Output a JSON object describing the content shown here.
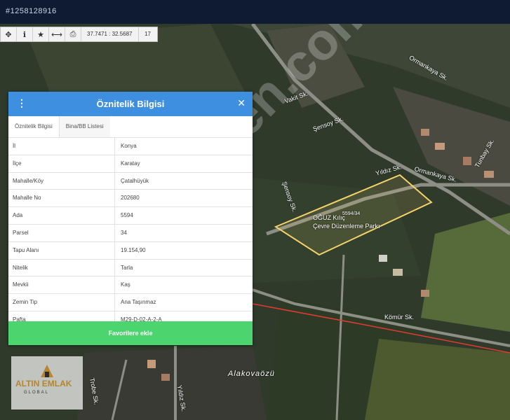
{
  "listing_id": "#1258128916",
  "toolbar": {
    "coordinates": "37.7471 : 32.5687",
    "zoom": "17"
  },
  "panel": {
    "title": "Öznitelik Bilgisi",
    "tabs": [
      "Öznitelik Bilgisi",
      "Bina/BB Listesi"
    ],
    "rows": [
      {
        "key": "İl",
        "value": "Konya"
      },
      {
        "key": "İlçe",
        "value": "Karatay"
      },
      {
        "key": "Mahalle/Köy",
        "value": "Çatalhüyük"
      },
      {
        "key": "Mahalle No",
        "value": "202680"
      },
      {
        "key": "Ada",
        "value": "5594"
      },
      {
        "key": "Parsel",
        "value": "34"
      },
      {
        "key": "Tapu Alanı",
        "value": "19.154,90"
      },
      {
        "key": "Nitelik",
        "value": "Tarla"
      },
      {
        "key": "Mevkii",
        "value": "Kaş"
      },
      {
        "key": "Zemin Tip",
        "value": "Ana Taşınmaz"
      },
      {
        "key": "Pafta",
        "value": "M29-D-02-A-2-A"
      }
    ],
    "favorite_button": "Favorilere ekle"
  },
  "map": {
    "streets": [
      "Ormankaya Sk.",
      "Vakit Sk.",
      "Şensoy Sk.",
      "Tunbay Sk.",
      "Yıldız Sk.",
      "Ormankaya Sk.",
      "Şensoy Sk.",
      "Kömür Sk.",
      "Alakovaözü",
      "Yıldız Sk.",
      "Trobe Sk."
    ],
    "parcel": {
      "label_line1": "OĞUZ Kılıç",
      "label_line2": "Çevre Düzenleme Parkı",
      "number": "5594/34"
    },
    "watermark": "sahibinden.com"
  },
  "logo": {
    "title": "ALTIN EMLAK",
    "subtitle": "GLOBAL"
  },
  "colors": {
    "header": "#3f8fe0",
    "favorite": "#4cd46f",
    "topbar": "#0f1b33",
    "parcel_outline": "#f3d36b",
    "boundary": "#e23b2e"
  }
}
